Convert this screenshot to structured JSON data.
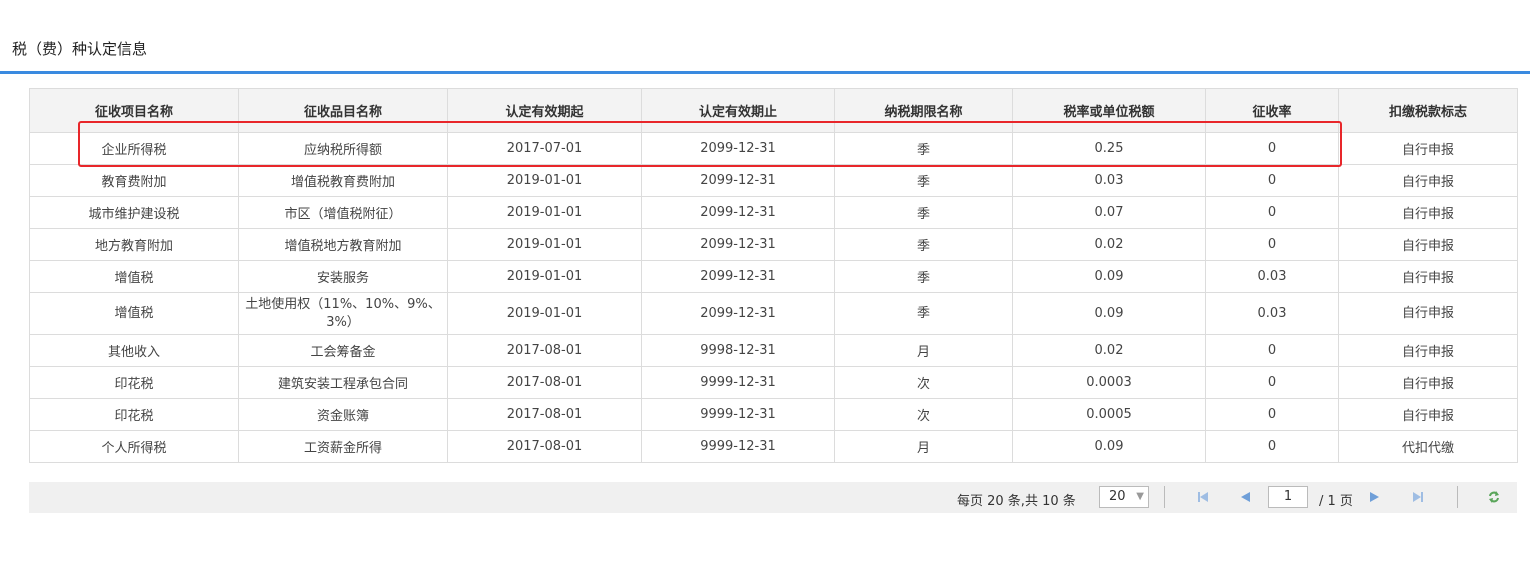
{
  "section": {
    "title": "税（费）种认定信息"
  },
  "table": {
    "headers": [
      "征收项目名称",
      "征收品目名称",
      "认定有效期起",
      "认定有效期止",
      "纳税期限名称",
      "税率或单位税额",
      "征收率",
      "扣缴税款标志"
    ],
    "rows": [
      [
        "企业所得税",
        "应纳税所得额",
        "2017-07-01",
        "2099-12-31",
        "季",
        "0.25",
        "0",
        "自行申报"
      ],
      [
        "教育费附加",
        "增值税教育费附加",
        "2019-01-01",
        "2099-12-31",
        "季",
        "0.03",
        "0",
        "自行申报"
      ],
      [
        "城市维护建设税",
        "市区（增值税附征）",
        "2019-01-01",
        "2099-12-31",
        "季",
        "0.07",
        "0",
        "自行申报"
      ],
      [
        "地方教育附加",
        "增值税地方教育附加",
        "2019-01-01",
        "2099-12-31",
        "季",
        "0.02",
        "0",
        "自行申报"
      ],
      [
        "增值税",
        "安装服务",
        "2019-01-01",
        "2099-12-31",
        "季",
        "0.09",
        "0.03",
        "自行申报"
      ],
      [
        "增值税",
        "土地使用权（11%、10%、9%、3%）",
        "2019-01-01",
        "2099-12-31",
        "季",
        "0.09",
        "0.03",
        "自行申报"
      ],
      [
        "其他收入",
        "工会筹备金",
        "2017-08-01",
        "9998-12-31",
        "月",
        "0.02",
        "0",
        "自行申报"
      ],
      [
        "印花税",
        "建筑安装工程承包合同",
        "2017-08-01",
        "9999-12-31",
        "次",
        "0.0003",
        "0",
        "自行申报"
      ],
      [
        "印花税",
        "资金账簿",
        "2017-08-01",
        "9999-12-31",
        "次",
        "0.0005",
        "0",
        "自行申报"
      ],
      [
        "个人所得税",
        "工资薪金所得",
        "2017-08-01",
        "9999-12-31",
        "月",
        "0.09",
        "0",
        "代扣代缴"
      ]
    ]
  },
  "pager": {
    "info": "每页 20 条,共 10 条",
    "page_size": "20",
    "current_page": "1",
    "total_pages": "/ 1 页"
  },
  "colors": {
    "accent": "#3a8ae0",
    "highlight": "#e8262a",
    "nav": "#7aa6d9"
  },
  "icons": [
    "first-page-icon",
    "prev-page-icon",
    "next-page-icon",
    "last-page-icon",
    "refresh-icon",
    "chevron-down-icon"
  ]
}
